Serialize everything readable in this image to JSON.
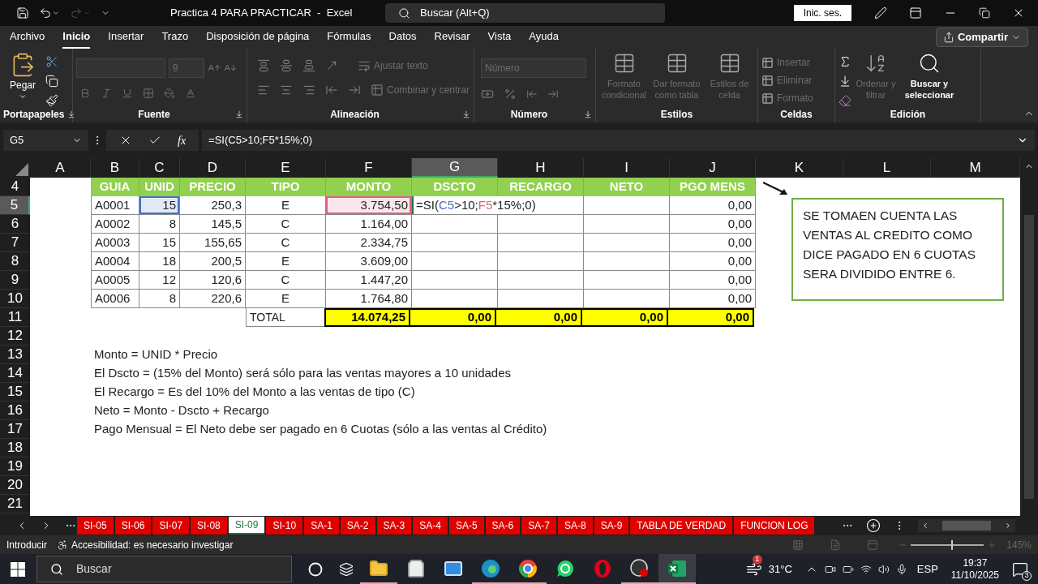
{
  "title_bar": {
    "title": "Practica 4 PARA PRACTICAR  -  Excel",
    "search": {
      "placeholder": "Buscar (Alt+Q)"
    },
    "sign_in": "Inic. ses."
  },
  "menu_tabs": [
    {
      "label": "Archivo",
      "selected": false
    },
    {
      "label": "Inicio",
      "selected": true
    },
    {
      "label": "Insertar",
      "selected": false
    },
    {
      "label": "Trazo",
      "selected": false
    },
    {
      "label": "Disposición de página",
      "selected": false
    },
    {
      "label": "Fórmulas",
      "selected": false
    },
    {
      "label": "Datos",
      "selected": false
    },
    {
      "label": "Revisar",
      "selected": false
    },
    {
      "label": "Vista",
      "selected": false
    },
    {
      "label": "Ayuda",
      "selected": false
    }
  ],
  "share_button": "Compartir",
  "ribbon": {
    "clipboard": {
      "label": "Portapapeles",
      "paste": "Pegar"
    },
    "font": {
      "label": "Fuente",
      "size": {
        "value": "9",
        "disabled": true
      }
    },
    "alignment": {
      "label": "Alineación",
      "commands": [
        {
          "label": "Ajustar texto",
          "disabled": true
        },
        {
          "label": "Combinar y centrar",
          "disabled": true
        }
      ]
    },
    "number": {
      "label": "Número",
      "format": {
        "value": "Número",
        "disabled": true
      }
    },
    "styles": {
      "label": "Estilos",
      "commands": [
        {
          "label": "Formato condicional",
          "disabled": true
        },
        {
          "label": "Dar formato como tabla",
          "disabled": true
        },
        {
          "label": "Estilos de celda",
          "disabled": true
        }
      ]
    },
    "cells": {
      "label": "Celdas",
      "commands": [
        {
          "label": "Insertar",
          "disabled": true
        },
        {
          "label": "Eliminar",
          "disabled": true
        },
        {
          "label": "Formato",
          "disabled": true
        }
      ]
    },
    "editing": {
      "label": "Edición",
      "commands": [
        {
          "label": "Ordenar y filtrar",
          "disabled": true
        },
        {
          "label": "Buscar y seleccionar",
          "disabled": false
        }
      ]
    }
  },
  "formula_bar": {
    "name_box": "G5",
    "insert_function": "fx",
    "formula": "=SI(C5>10;F5*15%;0)"
  },
  "sheet": {
    "columns": [
      {
        "label": "A",
        "selected": false
      },
      {
        "label": "B",
        "selected": false
      },
      {
        "label": "C",
        "selected": false
      },
      {
        "label": "D",
        "selected": false
      },
      {
        "label": "E",
        "selected": false
      },
      {
        "label": "F",
        "selected": false
      },
      {
        "label": "G",
        "selected": true
      },
      {
        "label": "H",
        "selected": false
      },
      {
        "label": "I",
        "selected": false
      },
      {
        "label": "J",
        "selected": false
      },
      {
        "label": "K",
        "selected": false
      },
      {
        "label": "L",
        "selected": false
      },
      {
        "label": "M",
        "selected": false
      }
    ],
    "rows": [
      {
        "number": "4",
        "selected": false,
        "kind": "header",
        "labels": [
          "GUIA",
          "UNID",
          "PRECIO",
          "TIPO",
          "MONTO",
          "DSCTO",
          "RECARGO",
          "NETO",
          "PGO MENS"
        ]
      },
      {
        "number": "5",
        "selected": true,
        "kind": "data",
        "cells": [
          {
            "text": "A0001"
          },
          {
            "text": "15",
            "color": "#4472c4"
          },
          {
            "text": "250,3"
          },
          {
            "text": "E"
          },
          {
            "text": "3.754,50",
            "color": "#e0607e"
          },
          {
            "kind": "formula",
            "parts": [
              {
                "text": "=SI("
              },
              {
                "text": "C5",
                "color": "#4472c4"
              },
              {
                "text": ">10;"
              },
              {
                "text": "F5",
                "color": "#e0607e"
              },
              {
                "text": "*15%;0)"
              }
            ]
          },
          {},
          {},
          {
            "text": "0,00"
          }
        ]
      },
      {
        "number": "6",
        "selected": false,
        "kind": "data",
        "cells": [
          {
            "text": "A0002"
          },
          {
            "text": "8"
          },
          {
            "text": "145,5"
          },
          {
            "text": "C"
          },
          {
            "text": "1.164,00"
          },
          {},
          {},
          {},
          {
            "text": "0,00"
          }
        ]
      },
      {
        "number": "7",
        "selected": false,
        "kind": "data",
        "cells": [
          {
            "text": "A0003"
          },
          {
            "text": "15"
          },
          {
            "text": "155,65"
          },
          {
            "text": "C"
          },
          {
            "text": "2.334,75"
          },
          {},
          {},
          {},
          {
            "text": "0,00"
          }
        ]
      },
      {
        "number": "8",
        "selected": false,
        "kind": "data",
        "cells": [
          {
            "text": "A0004"
          },
          {
            "text": "18"
          },
          {
            "text": "200,5"
          },
          {
            "text": "E"
          },
          {
            "text": "3.609,00"
          },
          {},
          {},
          {},
          {
            "text": "0,00"
          }
        ]
      },
      {
        "number": "9",
        "selected": false,
        "kind": "data",
        "cells": [
          {
            "text": "A0005"
          },
          {
            "text": "12"
          },
          {
            "text": "120,6"
          },
          {
            "text": "C"
          },
          {
            "text": "1.447,20"
          },
          {},
          {},
          {},
          {
            "text": "0,00"
          }
        ]
      },
      {
        "number": "10",
        "selected": false,
        "kind": "data",
        "cells": [
          {
            "text": "A0006"
          },
          {
            "text": "8"
          },
          {
            "text": "220,6"
          },
          {
            "text": "E"
          },
          {
            "text": "1.764,80"
          },
          {},
          {},
          {},
          {
            "text": "0,00"
          }
        ]
      },
      {
        "number": "11",
        "selected": false,
        "kind": "total",
        "label": "TOTAL",
        "values": [
          "14.074,25",
          "0,00",
          "0,00",
          "0,00",
          "0,00"
        ]
      },
      {
        "number": "12",
        "selected": false,
        "kind": "empty"
      },
      {
        "number": "13",
        "selected": false,
        "kind": "note",
        "text": "Monto = UNID * Precio"
      },
      {
        "number": "14",
        "selected": false,
        "kind": "note",
        "text": "El Dscto = (15% del Monto) será sólo para las ventas mayores a 10 unidades"
      },
      {
        "number": "15",
        "selected": false,
        "kind": "note",
        "text": "El Recargo = Es del 10% del Monto a las ventas de tipo (C)"
      },
      {
        "number": "16",
        "selected": false,
        "kind": "note",
        "text": "Neto = Monto - Dscto + Recargo"
      },
      {
        "number": "17",
        "selected": false,
        "kind": "note",
        "text": "Pago Mensual = El Neto debe ser pagado en 6 Cuotas (sólo a las ventas al Crédito)"
      },
      {
        "number": "18",
        "selected": false,
        "kind": "empty"
      },
      {
        "number": "19",
        "selected": false,
        "kind": "empty"
      },
      {
        "number": "20",
        "selected": false,
        "kind": "empty"
      },
      {
        "number": "21",
        "selected": false,
        "kind": "empty"
      }
    ],
    "note_box": "SE TOMAEN CUENTA LAS VENTAS AL CREDITO COMO DICE PAGADO EN 6 CUOTAS SERA DIVIDIDO ENTRE 6."
  },
  "sheet_tabs": [
    {
      "label": "SI-05",
      "selected": false
    },
    {
      "label": "SI-06",
      "selected": false
    },
    {
      "label": "SI-07",
      "selected": false
    },
    {
      "label": "SI-08",
      "selected": false
    },
    {
      "label": "SI-09",
      "selected": true
    },
    {
      "label": "SI-10",
      "selected": false
    },
    {
      "label": "SA-1",
      "selected": false
    },
    {
      "label": "SA-2",
      "selected": false
    },
    {
      "label": "SA-3",
      "selected": false
    },
    {
      "label": "SA-4",
      "selected": false
    },
    {
      "label": "SA-5",
      "selected": false
    },
    {
      "label": "SA-6",
      "selected": false
    },
    {
      "label": "SA-7",
      "selected": false
    },
    {
      "label": "SA-8",
      "selected": false
    },
    {
      "label": "SA-9",
      "selected": false
    },
    {
      "label": "TABLA DE VERDAD",
      "selected": false
    },
    {
      "label": "FUNCION LOG",
      "selected": false
    }
  ],
  "status_bar": {
    "mode": "Introducir",
    "accessibility": "Accesibilidad: es necesario investigar",
    "zoom": {
      "level": 0.55,
      "reading": "145%"
    }
  },
  "taskbar": {
    "search": {
      "placeholder": "Buscar"
    },
    "apps": [
      {
        "kind": "explorer",
        "running": true,
        "selected": false
      },
      {
        "kind": "store",
        "running": false,
        "selected": false
      },
      {
        "kind": "mail",
        "running": false,
        "selected": false
      },
      {
        "kind": "edge",
        "running": true,
        "selected": false
      },
      {
        "kind": "chrome",
        "running": true,
        "selected": false
      },
      {
        "kind": "whatsapp",
        "running": false,
        "selected": false
      },
      {
        "kind": "opera",
        "running": false,
        "selected": false
      },
      {
        "kind": "obs",
        "running": true,
        "selected": false
      },
      {
        "kind": "excel",
        "running": true,
        "selected": true
      }
    ],
    "weather": {
      "badge": "1",
      "temperature": "31°C"
    },
    "language": "ESP",
    "time": "19:37",
    "date": "11/10/2025",
    "notifications": "3"
  }
}
